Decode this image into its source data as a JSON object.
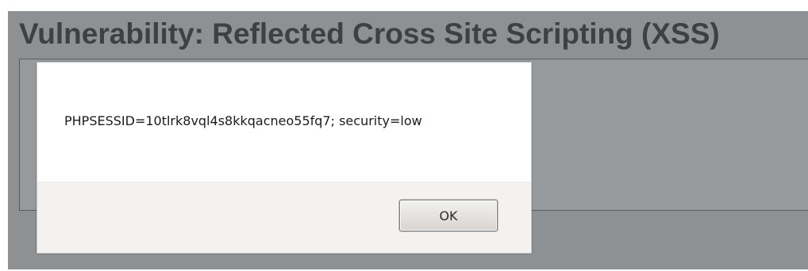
{
  "page": {
    "title": "Vulnerability: Reflected Cross Site Scripting (XSS)"
  },
  "alert": {
    "message": "PHPSESSID=10tlrk8vql4s8kkqacneo55fq7; security=low",
    "ok_label": "OK"
  },
  "colors": {
    "page_background": "#8e9193",
    "title_text": "#3e4144",
    "dialog_background": "#ffffff",
    "dialog_footer": "#f3f2f1"
  }
}
